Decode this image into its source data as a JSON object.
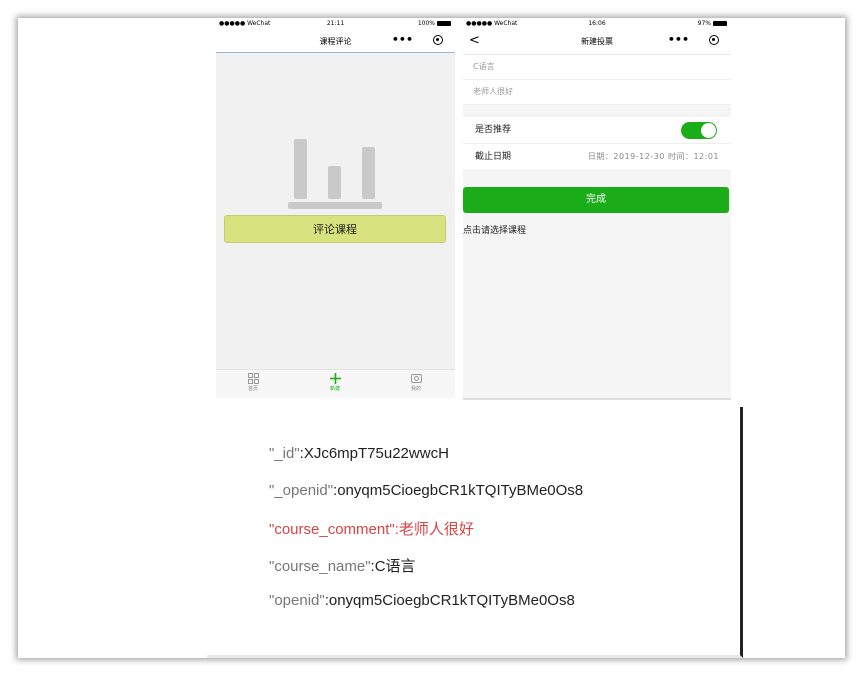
{
  "phone_left": {
    "status": {
      "carrier": "●●●●● WeChat",
      "time": "21:11",
      "battery": "100%"
    },
    "navbar": {
      "title": "课程评论",
      "more": "•••"
    },
    "comment_button": "评论课程",
    "tabs": [
      {
        "label": "首页",
        "icon": "grid-icon"
      },
      {
        "label": "新建",
        "icon": "plus-icon"
      },
      {
        "label": "我的",
        "icon": "camera-icon"
      }
    ]
  },
  "phone_right": {
    "status": {
      "carrier": "●●●●● WeChat",
      "time": "16:06",
      "battery": "97%"
    },
    "navbar": {
      "title": "新建投票",
      "back": "<",
      "more": "•••"
    },
    "course_name_value": "C语言",
    "comment_value": "老师人很好",
    "recommend_label": "是否推荐",
    "recommend_on": true,
    "deadline_label": "截止日期",
    "deadline_value": "日期：2019-12-30  时间：12:01",
    "done_button": "完成",
    "pick_hint": "点击请选择课程"
  },
  "record": [
    {
      "key": "\"_id\"",
      "value": ":XJc6mpT75u22wwcH",
      "highlight": false
    },
    {
      "key": "\"_openid\"",
      "value": ":onyqm5CioegbCR1kTQITyBMe0Os8",
      "highlight": false
    },
    {
      "key": "\"course_comment\"",
      "value": ":老师人很好",
      "highlight": true
    },
    {
      "key": "\"course_name\"",
      "value": ":C语言",
      "highlight": false
    },
    {
      "key": "\"openid\"",
      "value": ":onyqm5CioegbCR1kTQITyBMe0Os8",
      "highlight": false
    }
  ],
  "colors": {
    "accent_green": "#1aad19",
    "button_yellow": "#d8e27e",
    "highlight_red": "#d94444"
  }
}
